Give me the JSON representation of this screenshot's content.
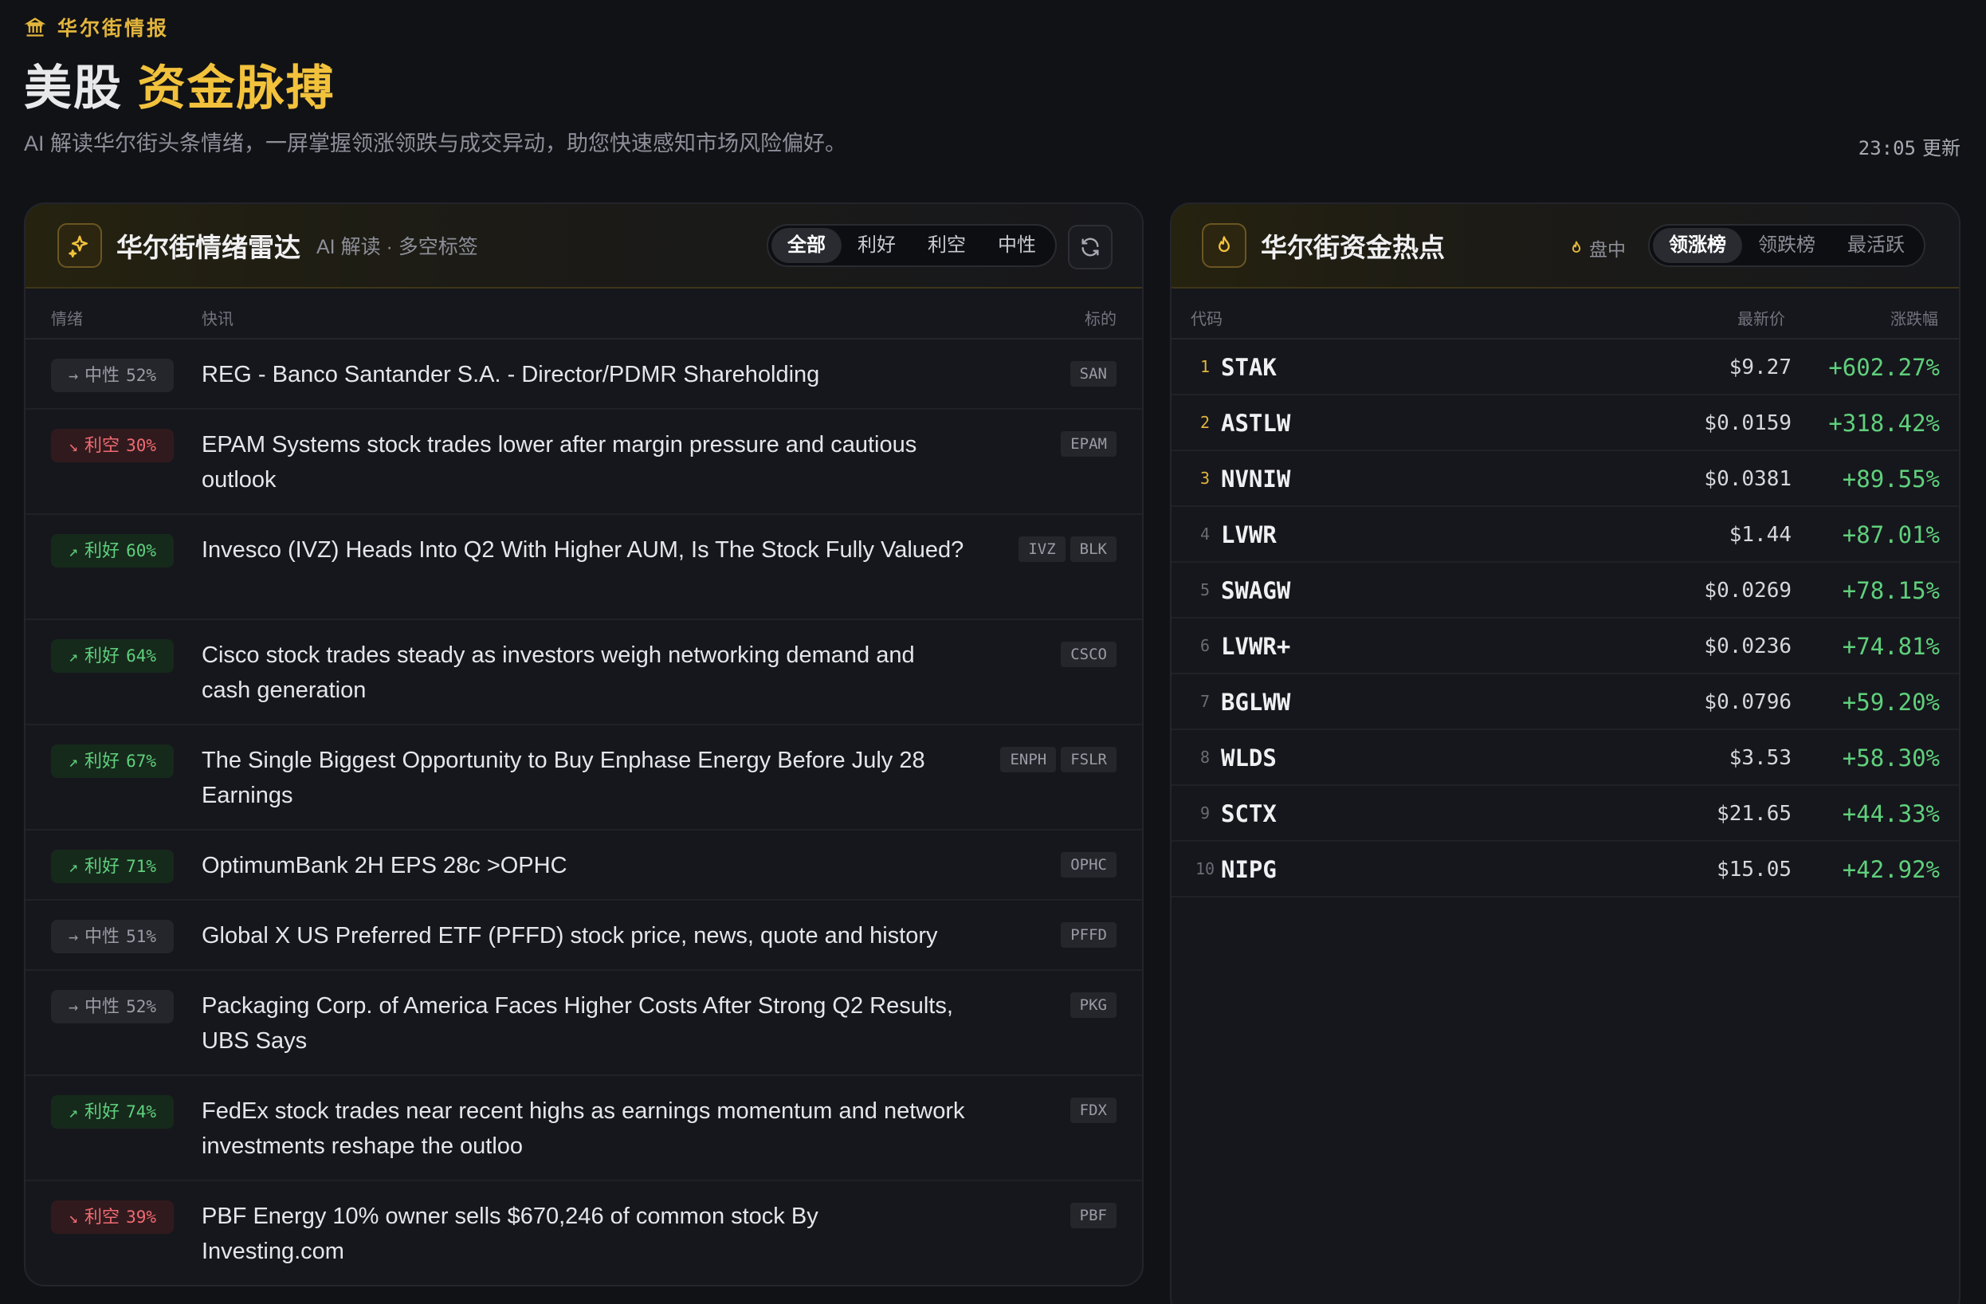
{
  "header": {
    "brand_label": "华尔街情报",
    "title_main": "美股",
    "title_accent": "资金脉搏",
    "subtitle": "AI 解读华尔街头条情绪，一屏掌握领涨领跌与成交异动，助您快速感知市场风险偏好。",
    "update_time": "23:05",
    "update_label": "更新"
  },
  "sentiment_panel": {
    "icon": "sparkle-icon",
    "title": "华尔街情绪雷达",
    "subtitle": "AI 解读 · 多空标签",
    "filters": [
      {
        "label": "全部",
        "active": true
      },
      {
        "label": "利好",
        "active": false
      },
      {
        "label": "利空",
        "active": false
      },
      {
        "label": "中性",
        "active": false
      }
    ],
    "refresh_icon": "refresh-icon",
    "columns": {
      "sentiment": "情绪",
      "news": "快讯",
      "ticker": "标的"
    },
    "rows": [
      {
        "type": "neu",
        "arrow": "→",
        "label": "中性",
        "pct": "52%",
        "title": "REG - Banco Santander S.A. - Director/PDMR Shareholding",
        "tags": [
          "SAN"
        ],
        "lines": 1
      },
      {
        "type": "neg",
        "arrow": "↘",
        "label": "利空",
        "pct": "30%",
        "title": "EPAM Systems stock trades lower after margin pressure and cautious outlook",
        "tags": [
          "EPAM"
        ],
        "lines": 2
      },
      {
        "type": "pos",
        "arrow": "↗",
        "label": "利好",
        "pct": "60%",
        "title": "Invesco (IVZ) Heads Into Q2 With Higher AUM, Is The Stock Fully Valued?",
        "tags": [
          "IVZ",
          "BLK"
        ],
        "lines": 2
      },
      {
        "type": "pos",
        "arrow": "↗",
        "label": "利好",
        "pct": "64%",
        "title": "Cisco stock trades steady as investors weigh networking demand and cash generation",
        "tags": [
          "CSCO"
        ],
        "lines": 2
      },
      {
        "type": "pos",
        "arrow": "↗",
        "label": "利好",
        "pct": "67%",
        "title": "The Single Biggest Opportunity to Buy Enphase Energy Before July 28 Earnings",
        "tags": [
          "ENPH",
          "FSLR"
        ],
        "lines": 2
      },
      {
        "type": "pos",
        "arrow": "↗",
        "label": "利好",
        "pct": "71%",
        "title": "OptimumBank 2H EPS 28c >OPHC",
        "tags": [
          "OPHC"
        ],
        "lines": 1
      },
      {
        "type": "neu",
        "arrow": "→",
        "label": "中性",
        "pct": "51%",
        "title": "Global X US Preferred ETF (PFFD) stock price, news, quote and history",
        "tags": [
          "PFFD"
        ],
        "lines": 1
      },
      {
        "type": "neu",
        "arrow": "→",
        "label": "中性",
        "pct": "52%",
        "title": "Packaging Corp. of America Faces Higher Costs After Strong Q2 Results, UBS Says",
        "tags": [
          "PKG"
        ],
        "lines": 2
      },
      {
        "type": "pos",
        "arrow": "↗",
        "label": "利好",
        "pct": "74%",
        "title": "FedEx stock trades near recent highs as earnings momentum and network investments reshape the outloo",
        "tags": [
          "FDX"
        ],
        "lines": 2
      },
      {
        "type": "neg",
        "arrow": "↘",
        "label": "利空",
        "pct": "39%",
        "title": "PBF Energy 10% owner sells $670,246 of common stock By Investing.com",
        "tags": [
          "PBF"
        ],
        "lines": 2
      }
    ]
  },
  "hot_panel": {
    "icon": "flame-icon",
    "title": "华尔街资金热点",
    "live_label": "盘中",
    "tabs": [
      {
        "label": "领涨榜",
        "active": true
      },
      {
        "label": "领跌榜",
        "active": false
      },
      {
        "label": "最活跃",
        "active": false
      }
    ],
    "columns": {
      "code": "代码",
      "price": "最新价",
      "change": "涨跌幅"
    },
    "rows": [
      {
        "rank": "1",
        "symbol": "STAK",
        "price": "$9.27",
        "change": "+602.27%"
      },
      {
        "rank": "2",
        "symbol": "ASTLW",
        "price": "$0.0159",
        "change": "+318.42%"
      },
      {
        "rank": "3",
        "symbol": "NVNIW",
        "price": "$0.0381",
        "change": "+89.55%"
      },
      {
        "rank": "4",
        "symbol": "LVWR",
        "price": "$1.44",
        "change": "+87.01%"
      },
      {
        "rank": "5",
        "symbol": "SWAGW",
        "price": "$0.0269",
        "change": "+78.15%"
      },
      {
        "rank": "6",
        "symbol": "LVWR+",
        "price": "$0.0236",
        "change": "+74.81%"
      },
      {
        "rank": "7",
        "symbol": "BGLWW",
        "price": "$0.0796",
        "change": "+59.20%"
      },
      {
        "rank": "8",
        "symbol": "WLDS",
        "price": "$3.53",
        "change": "+58.30%"
      },
      {
        "rank": "9",
        "symbol": "SCTX",
        "price": "$21.65",
        "change": "+44.33%"
      },
      {
        "rank": "10",
        "symbol": "NIPG",
        "price": "$15.05",
        "change": "+42.92%"
      }
    ]
  },
  "colors": {
    "accent": "#f2c23c",
    "positive": "#5fd07c",
    "negative": "#ef6b72",
    "background": "#111216"
  }
}
